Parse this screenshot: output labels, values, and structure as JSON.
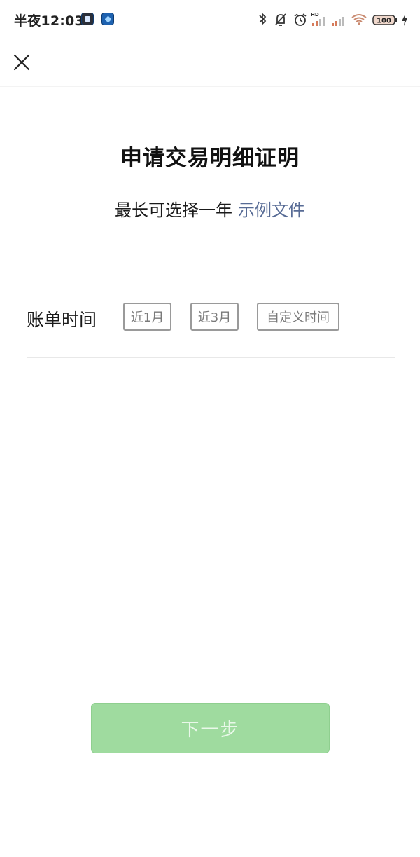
{
  "status_bar": {
    "time": "半夜12:03",
    "battery_level": "100",
    "icons": [
      "bluetooth-icon",
      "mute-icon",
      "alarm-icon",
      "signal-hd-icon",
      "signal-icon",
      "wifi-icon",
      "battery-icon",
      "charging-icon"
    ]
  },
  "header": {
    "close_icon": "close-icon"
  },
  "main": {
    "title": "申请交易明细证明",
    "subtitle_text": "最长可选择一年",
    "sample_link": "示例文件",
    "bill_time_label": "账单时间",
    "range_options": [
      "近1月",
      "近3月",
      "自定义时间"
    ]
  },
  "footer": {
    "next_label": "下一步"
  },
  "colors": {
    "link": "#576b95",
    "button_disabled": "#9fdb9f"
  }
}
